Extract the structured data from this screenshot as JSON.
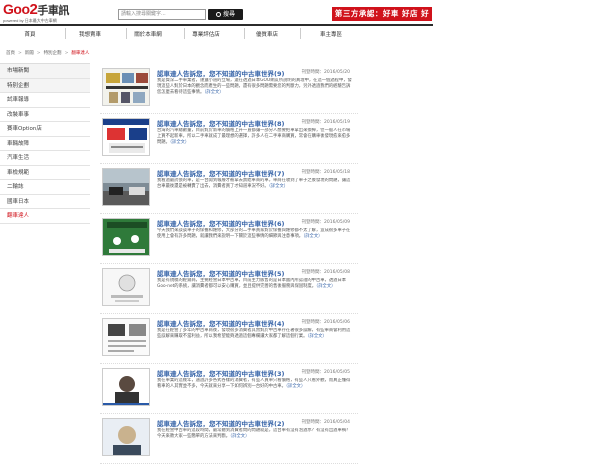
{
  "header": {
    "logo_text_goo": "Goo",
    "logo_text_num": "2",
    "logo_text_zh": "手車訊",
    "logo_sub": "powered by 日本最大中古車網",
    "search_placeholder": "請輸入搜尋關鍵字...",
    "search_button": "搜尋",
    "slogan": "第三方承認：好車 好店 好平台"
  },
  "nav": {
    "items": [
      "首頁",
      "我想賣車",
      "關於本車網",
      "專業評估店",
      "優質車店",
      "車主專區"
    ]
  },
  "breadcrumb": {
    "items": [
      "首頁",
      "新聞",
      "特別企劃"
    ],
    "current": "翻車達人"
  },
  "sidebar": {
    "items": [
      {
        "label": "市場新聞",
        "type": "main"
      },
      {
        "label": "特別企劃",
        "type": "main"
      },
      {
        "label": "試車報導",
        "type": "sub"
      },
      {
        "label": "改裝車事",
        "type": "sub"
      },
      {
        "label": "賽車Option店",
        "type": "sub"
      },
      {
        "label": "車輛故障",
        "type": "sub"
      },
      {
        "label": "汽車生活",
        "type": "sub"
      },
      {
        "label": "車檢規範",
        "type": "sub"
      },
      {
        "label": "二輪誌",
        "type": "sub"
      },
      {
        "label": "國車日本",
        "type": "sub"
      },
      {
        "label": "翻車達人",
        "type": "sub",
        "active": true
      }
    ]
  },
  "articles": [
    {
      "title": "認車達人告訴您，您不知道的中古車世界(9)",
      "meta": "刊登時間：2016/05/20",
      "excerpt": "我是資深二手車業者，謹遵小道的立場，還在透過日本GOO網友所說明的真理中，在這一個過程中，發現這些人對於日本的觀念而產生的一些問題，還有很多問題需要您的判斷力，另外透過我們的經驗告訴您怎麼去看待這些事情。",
      "more": "（詳全文）"
    },
    {
      "title": "認車達人告訴您，您不知道的中古車世界(8)",
      "meta": "刊登時間：2016/05/19",
      "excerpt": "台灣的汽車總數量，目前對於新車的價格上升一直都讓一部分人想要把車拿出來換掉，但一般人在市場上買不起新車，所以二手車就成了最理想的選擇，許多人在二手車商購買，常會在購車後發現愈來愈多問題。",
      "more": "（詳全文）"
    },
    {
      "title": "認車達人告訴您，您不知道的中古車世界(7)",
      "meta": "刊登時間：2016/05/18",
      "excerpt": "我看過最誇張的車，是一台開到報廢才被拿去賣給車商的車，車商在收到了車子之後發現的問題，讓這台車最後還是被轉賣了出去，消費者買了才知道車況不好。",
      "more": "（詳全文）"
    },
    {
      "title": "認車達人告訴您，您不知道的中古車世界(6)",
      "meta": "刊登時間：2016/05/09",
      "excerpt": "今天我們來談談車子的保養和維修，大部分的二手車買家對於保養與維修都不太了解，造成很多車子在使用上會有許多問題，就讓我們來說明一下關於這些事情的細節與注意事項。",
      "more": "（詳全文）"
    },
    {
      "title": "認車達人告訴您，您不知道的中古車世界(5)",
      "meta": "刊登時間：2016/05/08",
      "excerpt": "我是有規模的經銷商，主要經營日本中古車，目前主力販售的是日本國內所認證的中古車，透過日本Goo-net的系統，讓消費者都可以安心購買，並且提供完善的售後服務與保固制度。",
      "more": "（詳全文）"
    },
    {
      "title": "認車達人告訴您，您不知道的中古車世界(4)",
      "meta": "刊登時間：2016/05/06",
      "excerpt": "我是在經營了多年的中古車商後，發現很多消費者其實對於中古車存在著很多誤解，有些車商會利用這些誤解來賺取不當利益，所以我希望能夠透過這個專欄讓大家都了解這個行業。",
      "more": "（詳全文）"
    },
    {
      "title": "認車達人告訴您，您不知道的中古車世界(3)",
      "meta": "刊登時間：2016/05/05",
      "excerpt": "我在車業的這幾年，遇過許多各式各樣的消費者，有些人買車只看價格，有些人只看外觀，而真正懂得看車的人其實並不多，今天就來分享一下如何辨別一台好的中古車。",
      "more": "（詳全文）"
    },
    {
      "title": "認車達人告訴您，您不知道的中古車世界(2)",
      "meta": "刊登時間：2016/05/04",
      "excerpt": "我在經營中古車的這段時間，最常聽到消費者問的問題就是，這台車有沒有泡過水？有沒有出過車禍？今天來教大家一些簡單的方法來判斷。",
      "more": "（詳全文）"
    }
  ]
}
